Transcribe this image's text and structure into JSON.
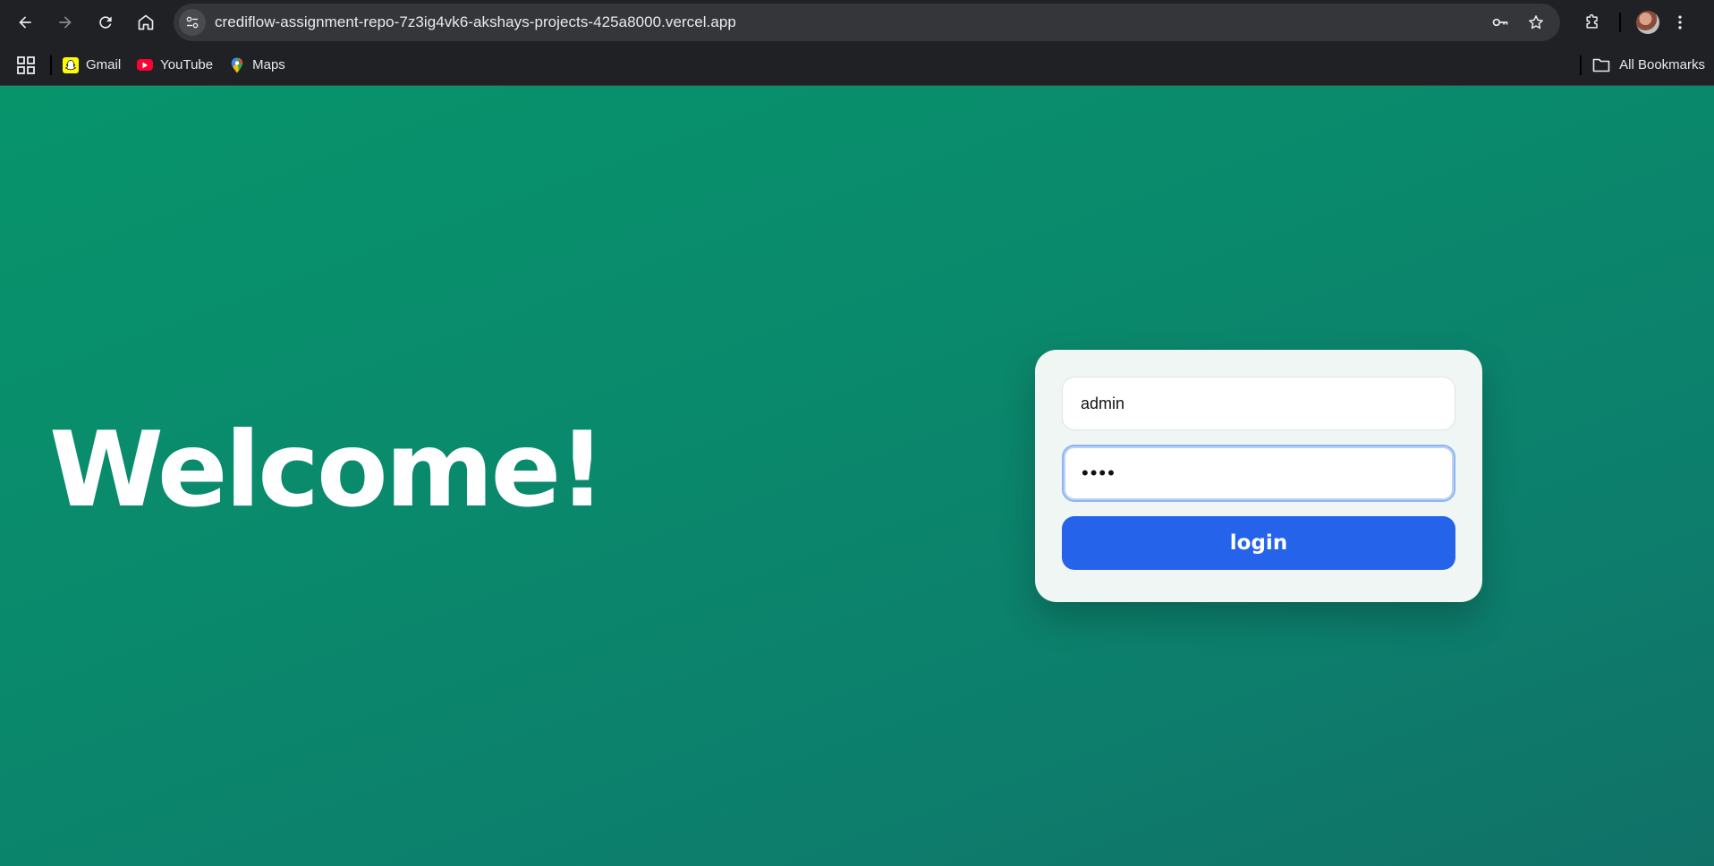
{
  "browser": {
    "url": "crediflow-assignment-repo-7z3ig4vk6-akshays-projects-425a8000.vercel.app",
    "bookmarks": [
      {
        "label": "Gmail",
        "icon": "snapchat-icon"
      },
      {
        "label": "YouTube",
        "icon": "youtube-icon"
      },
      {
        "label": "Maps",
        "icon": "maps-icon"
      }
    ],
    "all_bookmarks_label": "All Bookmarks"
  },
  "page": {
    "heading": "Welcome!",
    "login_form": {
      "username_value": "admin",
      "password_value": "••••",
      "submit_label": "login"
    }
  },
  "colors": {
    "background_start": "#07946b",
    "background_end": "#117168",
    "card_bg": "#eff6f4",
    "button_bg": "#2563eb",
    "focus_ring": "#8fb4f2"
  }
}
